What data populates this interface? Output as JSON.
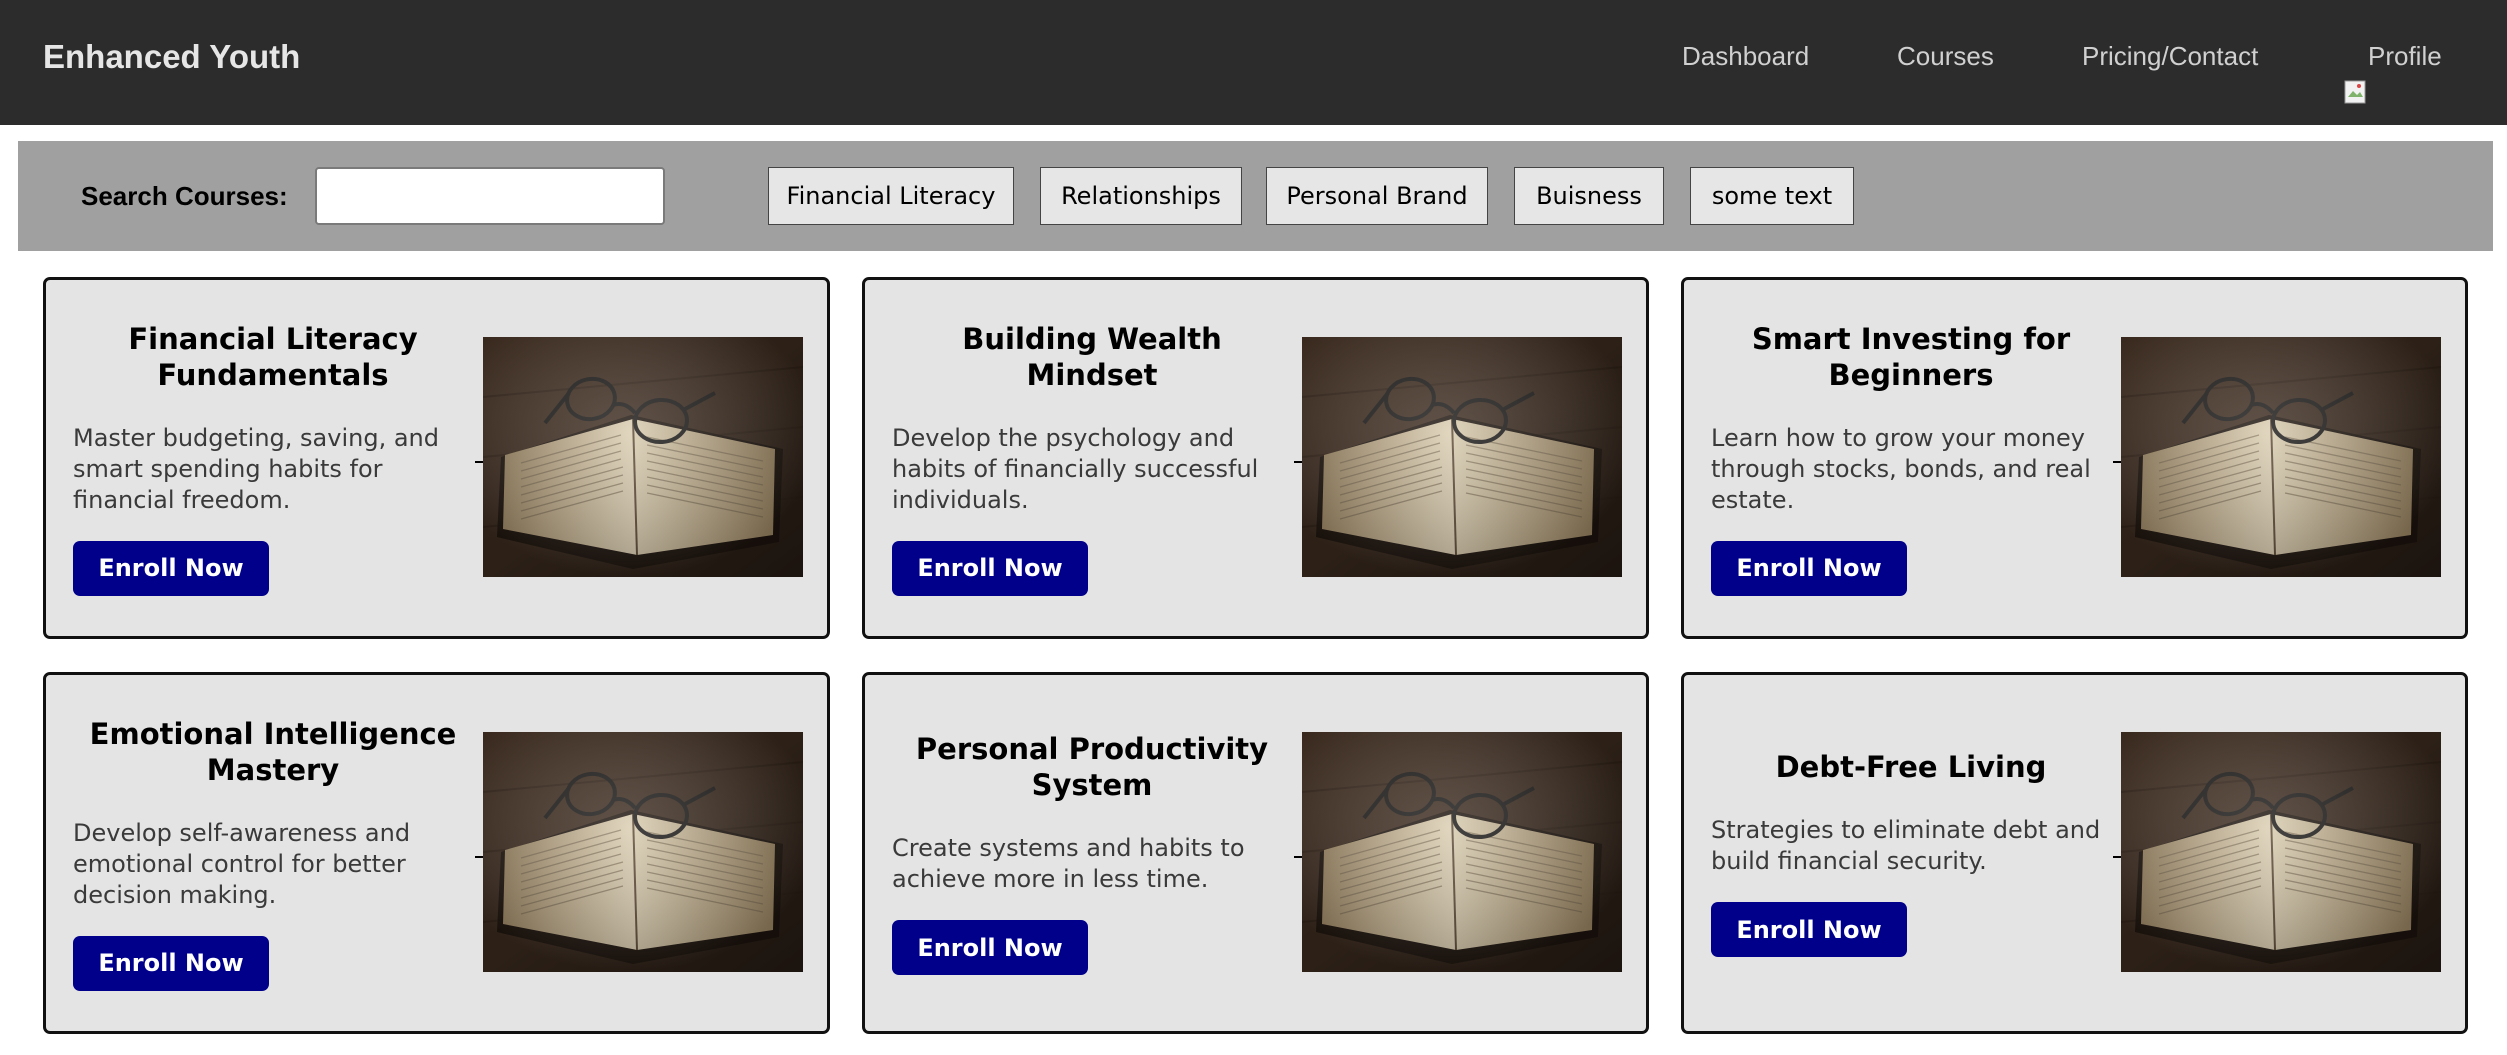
{
  "header": {
    "brand": "Enhanced Youth",
    "nav": {
      "dashboard": "Dashboard",
      "courses": "Courses",
      "pricing": "Pricing/Contact",
      "profile": "Profile"
    }
  },
  "search": {
    "label": "Search Courses:",
    "value": "",
    "placeholder": ""
  },
  "filters": [
    "Financial Literacy",
    "Relationships",
    "Personal Brand",
    "Buisness",
    "some text"
  ],
  "cards": [
    {
      "title": "Financial Literacy Fundamentals",
      "description": "Master budgeting, saving, and smart spending habits for financial freedom.",
      "button": "Enroll Now",
      "image": "open-book-with-glasses"
    },
    {
      "title": "Building Wealth Mindset",
      "description": "Develop the psychology and habits of financially successful individuals.",
      "button": "Enroll Now",
      "image": "open-book-with-glasses"
    },
    {
      "title": "Smart Investing for Beginners",
      "description": "Learn how to grow your money through stocks, bonds, and real estate.",
      "button": "Enroll Now",
      "image": "open-book-with-glasses"
    },
    {
      "title": "Emotional Intelligence Mastery",
      "description": "Develop self-awareness and emotional control for better decision making.",
      "button": "Enroll Now",
      "image": "open-book-with-glasses"
    },
    {
      "title": "Personal Productivity System",
      "description": "Create systems and habits to achieve more in less time.",
      "button": "Enroll Now",
      "image": "open-book-with-glasses"
    },
    {
      "title": "Debt-Free Living",
      "description": "Strategies to eliminate debt and build financial security.",
      "button": "Enroll Now",
      "image": "open-book-with-glasses"
    }
  ],
  "colors": {
    "header_bg": "#2c2c2c",
    "filter_bar_bg": "#a0a0a0",
    "card_bg": "#e4e4e4",
    "enroll_button": "#00008b"
  }
}
